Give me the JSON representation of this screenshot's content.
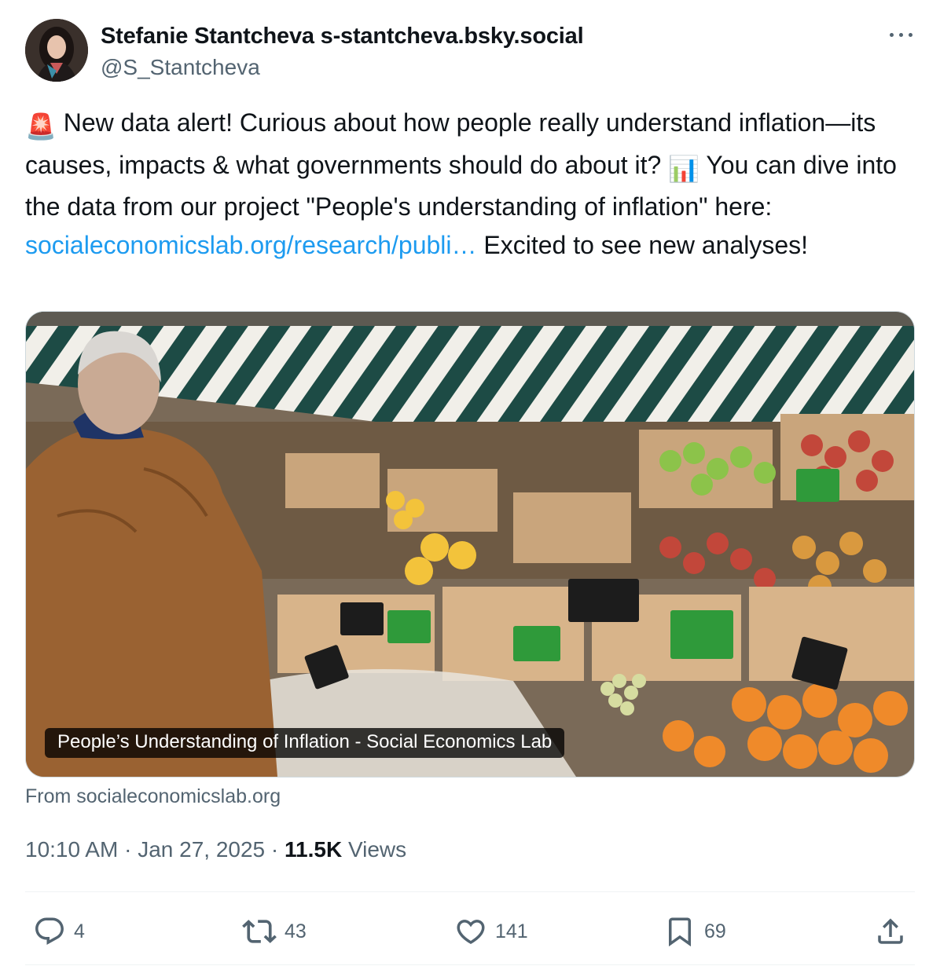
{
  "author": {
    "display_name": "Stefanie Stantcheva s-stantcheva.bsky.social",
    "handle": "@S_Stantcheva"
  },
  "tweet": {
    "siren_emoji": "🚨",
    "text_part1": " New data alert! Curious about how people really understand inflation—its causes, impacts & what governments should do about it? ",
    "chart_emoji": "📊",
    "text_part2": " You can dive into the data from our project \"People's understanding of inflation\" here: ",
    "link_text": "socialeconomicslab.org/research/publi…",
    "text_part3": " Excited to see new analyses!"
  },
  "card": {
    "title": "People’s Understanding of Inflation - Social Economics Lab",
    "source": "From socialeconomicslab.org",
    "image_icon": "market-photo"
  },
  "meta": {
    "time": "10:10 AM",
    "sep1": " · ",
    "date": "Jan 27, 2025",
    "sep2": " · ",
    "views_count": "11.5K",
    "views_label": " Views"
  },
  "actions": {
    "replies": "4",
    "reposts": "43",
    "likes": "141",
    "bookmarks": "69"
  },
  "colors": {
    "link": "#1d9bf0",
    "muted": "#536471",
    "text": "#0f1419",
    "border": "#cfd9de"
  }
}
